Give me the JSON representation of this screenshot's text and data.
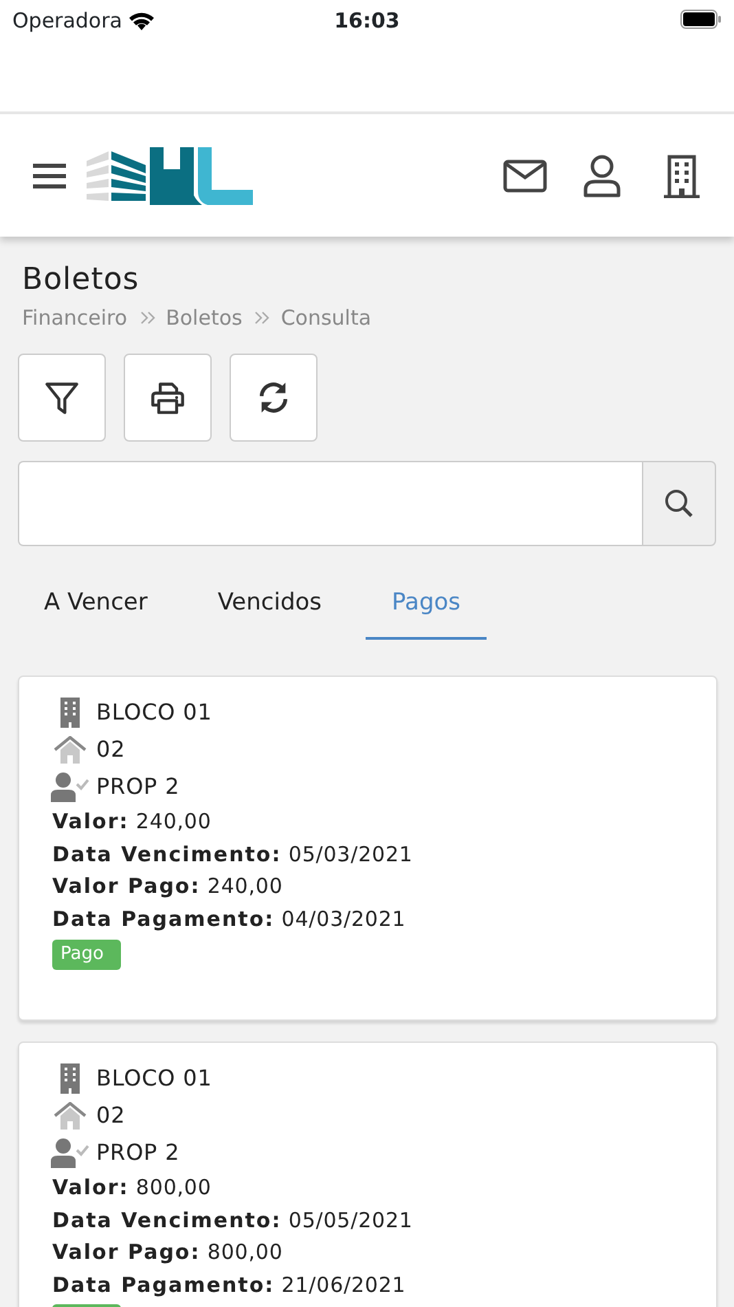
{
  "status_bar": {
    "carrier": "Operadora",
    "time": "16:03"
  },
  "page": {
    "title": "Boletos",
    "breadcrumb": [
      "Financeiro",
      "Boletos",
      "Consulta"
    ]
  },
  "toolbar": [
    {
      "kind": "filter"
    },
    {
      "kind": "print"
    },
    {
      "kind": "refresh"
    }
  ],
  "tabs": [
    {
      "label": "A Vencer",
      "selected": false
    },
    {
      "label": "Vencidos",
      "selected": false
    },
    {
      "label": "Pagos",
      "selected": true
    }
  ],
  "cards": [
    {
      "block": "BLOCO 01",
      "unit": "02",
      "owner": "PROP 2",
      "lines": [
        "**Valor:** 240,00",
        "**Data Vencimento:** 05/03/2021",
        "**Valor Pago:** 240,00",
        "**Data Pagamento:** 04/03/2021"
      ],
      "status": {
        "kind": "paid",
        "label": "Pago"
      }
    },
    {
      "block": "BLOCO 01",
      "unit": "02",
      "owner": "PROP 2",
      "lines": [
        "**Valor:** 800,00",
        "**Data Vencimento:** 05/05/2021",
        "**Valor Pago:** 800,00",
        "**Data Pagamento:** 21/06/2021"
      ],
      "status": {
        "kind": "paid"
      }
    }
  ]
}
